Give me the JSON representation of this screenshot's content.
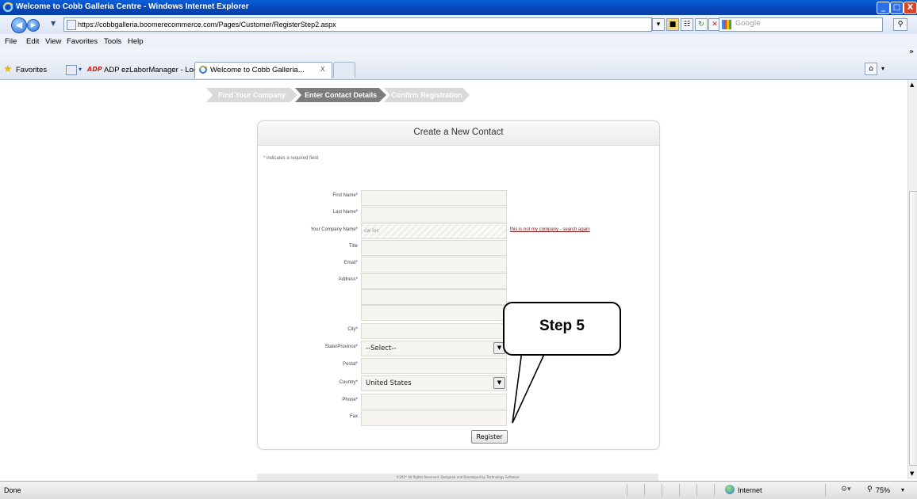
{
  "window": {
    "title": "Welcome to Cobb Galleria Centre - Windows Internet Explorer",
    "controls": [
      "_",
      "□",
      "X"
    ]
  },
  "address_bar": {
    "url": "https://cobbgalleria.boomerecommerce.com/Pages/Customer/RegisterStep2.aspx",
    "search_placeholder": "Google"
  },
  "menu": [
    "File",
    "Edit",
    "View",
    "Favorites",
    "Tools",
    "Help"
  ],
  "favorites_bar": {
    "favorites_label": "Favorites",
    "link": "ADP ezLaborManager - Login",
    "active_tab": "Welcome to Cobb Galleria...",
    "tab_close": "X"
  },
  "steps": [
    "Find Your Company",
    "Enter Contact Details",
    "Confirm Registration"
  ],
  "form": {
    "title": "Create a New Contact",
    "required_note": "* indicates a required field",
    "fields": [
      {
        "label": "First Name*"
      },
      {
        "label": "Last Name*"
      },
      {
        "label": "Your Company Name*",
        "value": "cw inc"
      },
      {
        "label": "Title"
      },
      {
        "label": "Email*"
      },
      {
        "label": "Address*"
      },
      {
        "label": "City*"
      },
      {
        "label": "State/Province*",
        "value": "--Select--"
      },
      {
        "label": "Postal*"
      },
      {
        "label": "Country*",
        "value": "United States"
      },
      {
        "label": "Phone*"
      },
      {
        "label": "Fax"
      }
    ],
    "company_link": "this is not my company - search again",
    "register_label": "Register",
    "footer": "©201* All Rights Reserved. Designed and Developed by Technology Software"
  },
  "callout": {
    "text": "Step 5"
  },
  "status_bar": {
    "status": "Done",
    "zone": "Internet",
    "zoom": "75%"
  },
  "colors": {
    "titlebar": "#0646b6",
    "step_active": "#7d7d7d",
    "step_inactive": "#d9d9d9",
    "link": "#8b1a1a"
  }
}
